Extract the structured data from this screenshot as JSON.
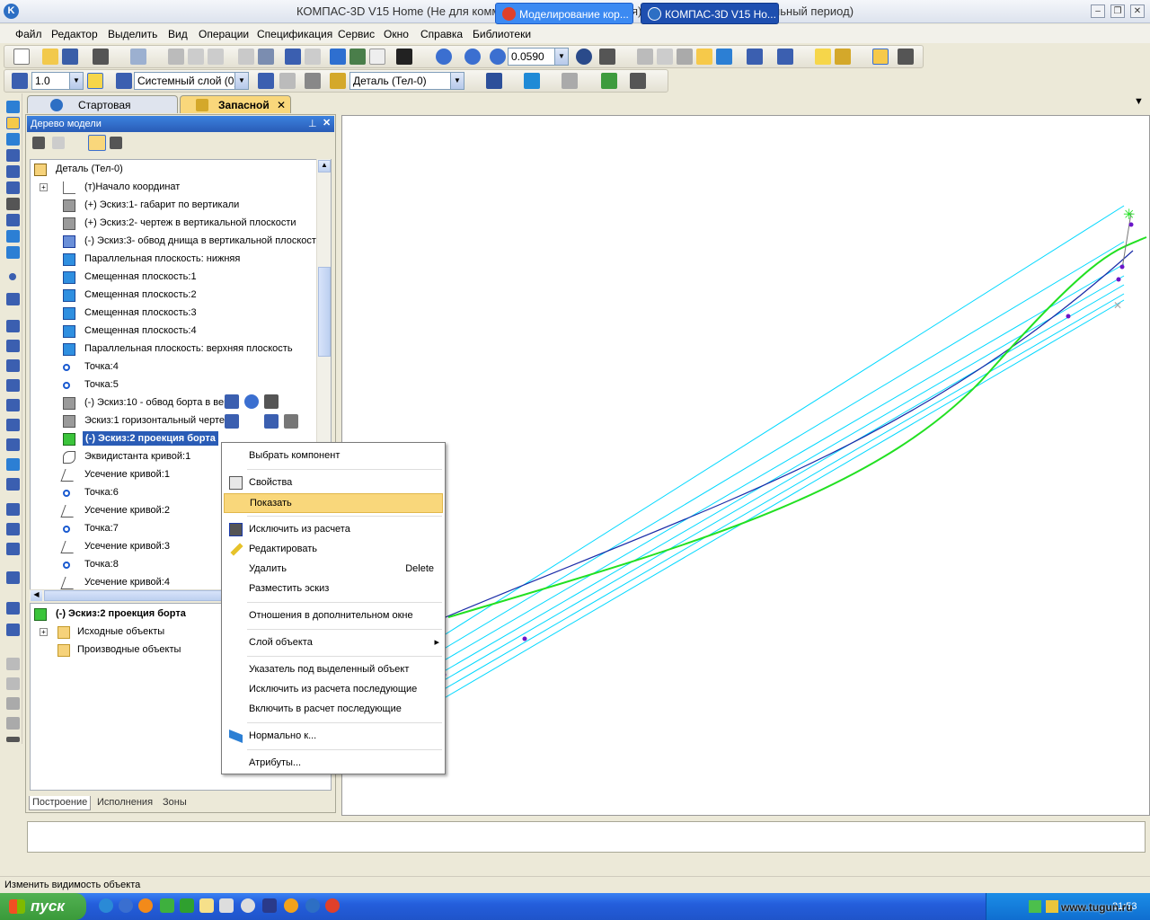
{
  "window": {
    "title": "КОМПАС-3D V15 Home (Не для коммерческого использования) - Запасной (ознакомительный период)"
  },
  "menubar": [
    "Файл",
    "Редактор",
    "Выделить",
    "Вид",
    "Операции",
    "Спецификация",
    "Сервис",
    "Окно",
    "Справка",
    "Библиотеки"
  ],
  "toolbar": {
    "scale_value": "0.0590",
    "step_value": "1.0",
    "layer_value": "Системный слой (0)",
    "part_value": "Деталь (Тел-0)"
  },
  "doc_tabs": [
    {
      "label": "Стартовая страница"
    },
    {
      "label": "Запасной",
      "close": "✕"
    }
  ],
  "model_tree": {
    "header": "Дерево модели",
    "root": "Деталь (Тел-0)",
    "items": [
      {
        "label": "(т)Начало координат",
        "icon": "origin-icon"
      },
      {
        "label": "(+) Эскиз:1- габарит по вертикали",
        "icon": "sketch-icon"
      },
      {
        "label": "(+) Эскиз:2- чертеж в вертикальной плоскости",
        "icon": "sketch-icon"
      },
      {
        "label": "(-) Эскиз:3- обвод днища в вертикальной плоскости",
        "icon": "sketch-blue-icon"
      },
      {
        "label": "Параллельная плоскость: нижняя",
        "icon": "plane-icon"
      },
      {
        "label": "Смещенная плоскость:1",
        "icon": "plane-icon"
      },
      {
        "label": "Смещенная плоскость:2",
        "icon": "plane-icon"
      },
      {
        "label": "Смещенная плоскость:3",
        "icon": "plane-icon"
      },
      {
        "label": "Смещенная плоскость:4",
        "icon": "plane-icon"
      },
      {
        "label": "Параллельная плоскость: верхняя плоскость",
        "icon": "plane-icon"
      },
      {
        "label": "Точка:4",
        "icon": "point-icon"
      },
      {
        "label": "Точка:5",
        "icon": "point-icon"
      },
      {
        "label": "(-) Эскиз:10 - обвод борта в вер",
        "suffix": "ст",
        "icon": "sketch-icon"
      },
      {
        "label": "Эскиз:1 горизонтальный черте",
        "icon": "sketch-icon"
      },
      {
        "label": "(-) Эскиз:2 проекция борта",
        "icon": "sketch-green-icon",
        "selected": true
      },
      {
        "label": "Эквидистанта кривой:1",
        "icon": "curve-icon"
      },
      {
        "label": "Усечение кривой:1",
        "icon": "trim-icon"
      },
      {
        "label": "Точка:6",
        "icon": "point-icon"
      },
      {
        "label": "Усечение кривой:2",
        "icon": "trim-icon"
      },
      {
        "label": "Точка:7",
        "icon": "point-icon"
      },
      {
        "label": "Усечение кривой:3",
        "icon": "trim-icon"
      },
      {
        "label": "Точка:8",
        "icon": "point-icon"
      },
      {
        "label": "Усечение кривой:4",
        "icon": "trim-icon"
      }
    ],
    "relations": {
      "title": "(-) Эскиз:2 проекция борта",
      "source": "Исходные объекты",
      "derived": "Производные объекты"
    },
    "tabs": [
      "Построение",
      "Исполнения",
      "Зоны"
    ]
  },
  "context_menu": {
    "items": [
      {
        "label": "Выбрать компонент"
      },
      {
        "label": "Свойства",
        "icon": "properties-icon"
      },
      {
        "label": "Показать",
        "highlight": true
      },
      {
        "label": "Исключить из расчета",
        "icon": "exclude-icon"
      },
      {
        "label": "Редактировать",
        "icon": "edit-pencil-icon"
      },
      {
        "label": "Удалить",
        "shortcut": "Delete"
      },
      {
        "label": "Разместить эскиз"
      },
      {
        "label": "Отношения в дополнительном окне"
      },
      {
        "label": "Слой объекта",
        "submenu": "▸"
      },
      {
        "label": "Указатель под выделенный объект"
      },
      {
        "label": "Исключить из расчета последующие"
      },
      {
        "label": "Включить в расчет последующие"
      },
      {
        "label": "Нормально к...",
        "icon": "normal-to-icon"
      },
      {
        "label": "Атрибуты..."
      }
    ]
  },
  "status": {
    "text": "Изменить видимость объекта"
  },
  "taskbar": {
    "start": "пуск",
    "buttons": [
      {
        "label": "Моделирование кор..."
      },
      {
        "label": "КОМПАС-3D V15 Ho..."
      }
    ],
    "lang": "RL",
    "watermark": "www.tugun.ru",
    "clock": "21:53"
  },
  "colors": {
    "accent": "#2a5cb6",
    "highlight": "#f9d77b",
    "cyan_lines": "#00d8ff",
    "green_curve": "#22e022",
    "blue_curve": "#1a2ca8"
  }
}
